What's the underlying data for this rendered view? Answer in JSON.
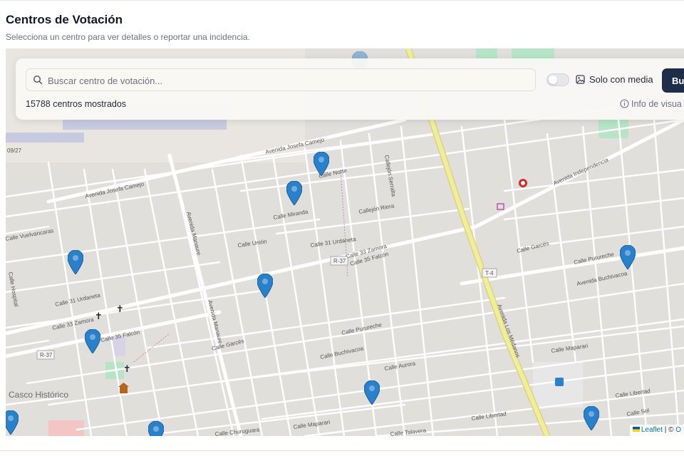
{
  "header": {
    "title": "Centros de Votación",
    "subtitle": "Selecciona un centro para ver detalles o reportar una incidencia."
  },
  "search": {
    "placeholder": "Buscar centro de votación...",
    "value": "",
    "icon": "search-icon"
  },
  "filters": {
    "media_toggle_on": false,
    "media_label": "Solo con media",
    "media_icon": "image-icon",
    "search_button_label": "Bu"
  },
  "results": {
    "count_text": "15788 centros mostrados",
    "info_label": "Info de visua",
    "info_icon": "info-icon"
  },
  "map": {
    "attribution_leaflet": "Leaflet",
    "attribution_sep": "| ©",
    "attribution_osm": "O",
    "district_label": "Casco Histórico",
    "marker_color": "#2a81cb",
    "road_labels": [
      "Avenida Josefa Camejo",
      "Avenida Josefa Camejo",
      "Calle Norte",
      "Calle Miranda",
      "Callejón Riera",
      "Callejón Serralta",
      "Calle Unión",
      "Calle 31 Urdaneta",
      "Calle 33 Zamora",
      "Calle 35 Falcón",
      "Calle 31 Urdaneta",
      "Calle 33 Zamora",
      "Calle 35 Falcón",
      "Calle Garcés",
      "Calle Garcés",
      "Calle Purureche",
      "Calle Purureche",
      "Avenida Buchivacoa",
      "Calle Buchivacoa",
      "Calle Aurora",
      "Calle Maparari",
      "Calle Maparari",
      "Calle Libertad",
      "Calle Libertad",
      "Calle Sol",
      "Avenida Independencia",
      "Avenida Los Médanos",
      "Avenida Manaure",
      "Avenida Manaure",
      "Calle Vuelvancaras",
      "Calle Hospital",
      "Calle Churuguara",
      "Calle Talavera",
      "R-37",
      "R-37",
      "T-4",
      "09/27"
    ]
  }
}
